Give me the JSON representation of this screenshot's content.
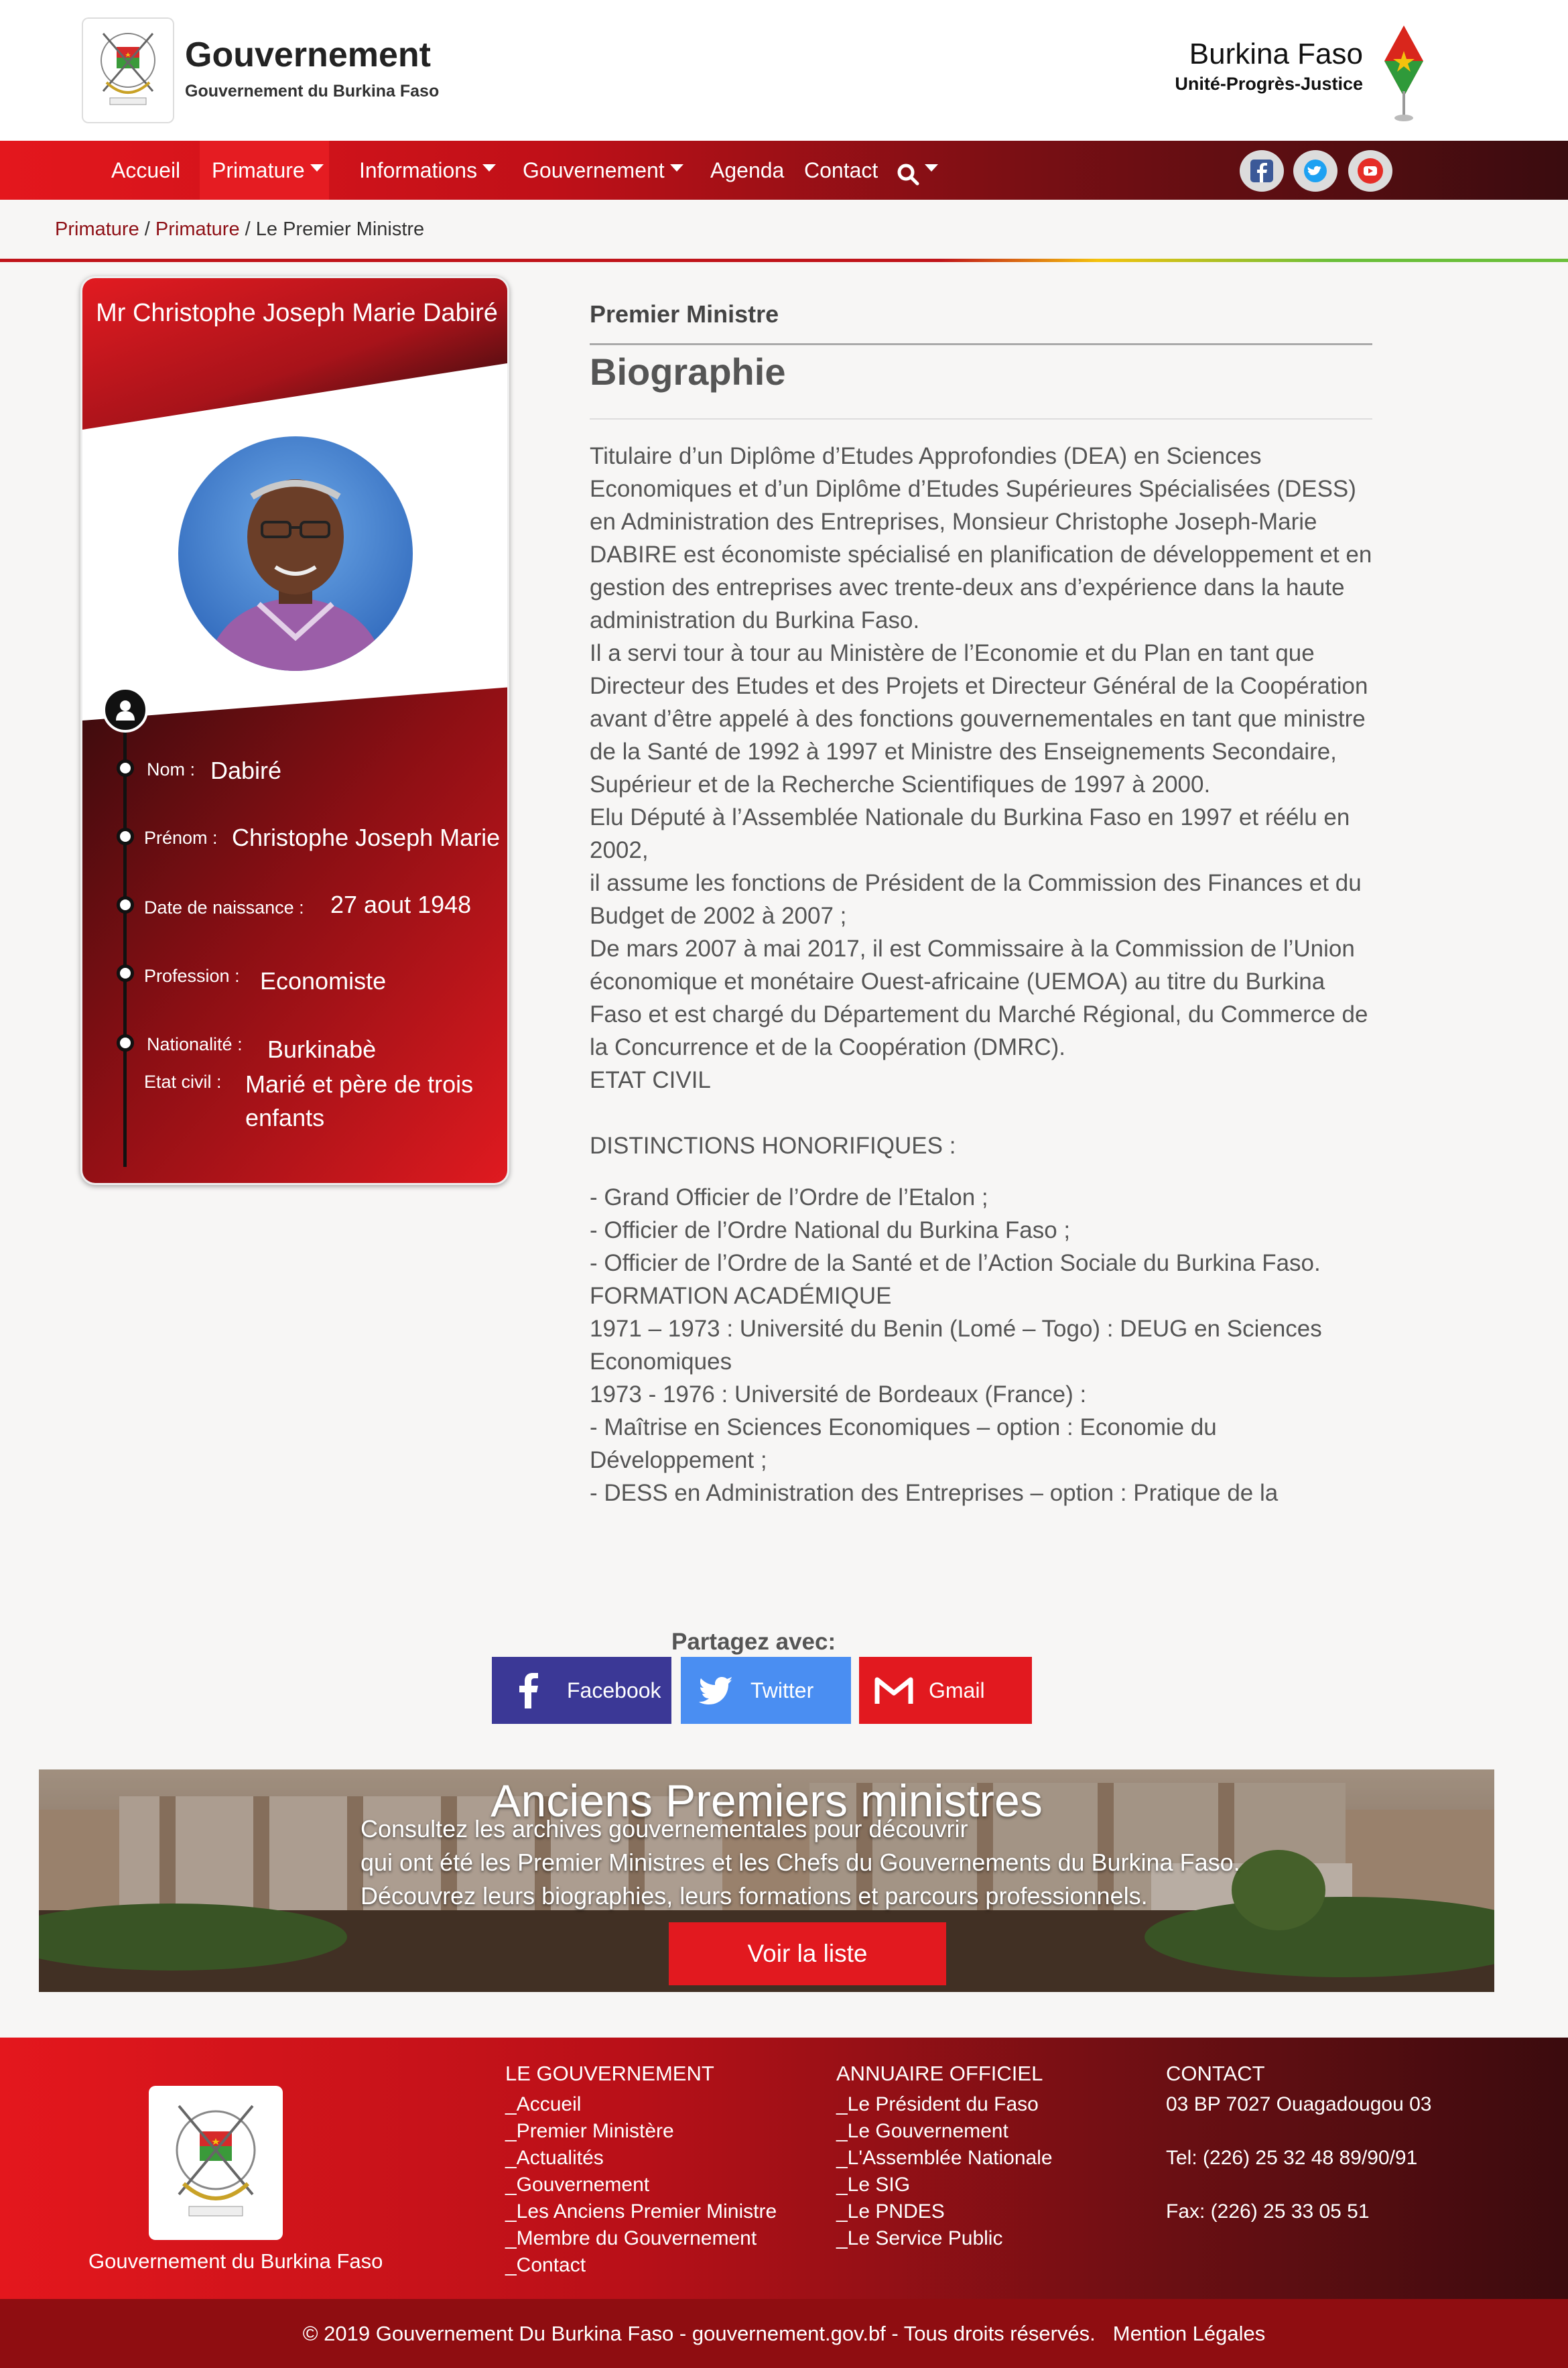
{
  "header": {
    "title": "Gouvernement",
    "subtitle": "Gouvernement du Burkina Faso",
    "country": "Burkina Faso",
    "motto": "Unité-Progrès-Justice"
  },
  "nav": {
    "items": [
      "Accueil",
      "Primature",
      "Informations",
      "Gouvernement",
      "Agenda",
      "Contact"
    ],
    "active": "Primature"
  },
  "social": [
    "facebook-icon",
    "twitter-icon",
    "youtube-icon"
  ],
  "breadcrumb": [
    "Primature",
    "Primature",
    "Le Premier Ministre"
  ],
  "profile": {
    "name": "Mr Christophe Joseph Marie Dabiré",
    "fields": [
      {
        "label": "Nom :",
        "value": "Dabiré"
      },
      {
        "label": "Prénom :",
        "value": "Christophe Joseph Marie"
      },
      {
        "label": "Date de naissance :",
        "value": "27 aout 1948"
      },
      {
        "label": "Profession :",
        "value": "Economiste"
      },
      {
        "label": "Nationalité :",
        "value": "Burkinabè"
      },
      {
        "label": "Etat civil :",
        "value": "Marié et père de trois enfants"
      }
    ]
  },
  "bio": {
    "kicker": "Premier Ministre",
    "title": "Biographie",
    "p1": "Titulaire d’un Diplôme d’Etudes Approfondies (DEA) en Sciences Economiques et d’un Diplôme d’Etudes Supérieures Spécialisées (DESS) en Administration des Entreprises, Monsieur Christophe Joseph-Marie DABIRE est économiste spécialisé en planification de développement et en gestion des entreprises avec trente-deux ans d’expérience dans la haute administration du Burkina Faso.",
    "p2": "Il a servi tour à tour au Ministère de l’Economie et du Plan en tant que Directeur des Etudes et des Projets et Directeur Général de la Coopération avant d’être appelé à des fonctions gouvernementales en tant que ministre de la Santé de 1992 à 1997 et Ministre des Enseignements Secondaire, Supérieur et de la Recherche Scientifiques de 1997 à 2000.",
    "p3": "Elu Député à l’Assemblée Nationale du Burkina Faso en 1997 et réélu en 2002,",
    "p4": "il assume les fonctions de Président de la Commission des Finances et du Budget de 2002 à 2007 ;",
    "p5": "De mars 2007 à mai 2017, il est Commissaire à la Commission de l’Union économique et monétaire Ouest-africaine (UEMOA) au titre du Burkina Faso et est chargé du Département du Marché Régional, du Commerce de la Concurrence et de la Coopération (DMRC).",
    "p6": "ETAT CIVIL",
    "p7": "DISTINCTIONS HONORIFIQUES :",
    "d1": "- Grand Officier de l’Ordre de l’Etalon ;",
    "d2": "- Officier de l’Ordre National du Burkina Faso ;",
    "d3": "- Officier de l’Ordre de la Santé et de l’Action Sociale du Burkina Faso.",
    "f0": "FORMATION ACADÉMIQUE",
    "f1": "1971 – 1973 : Université du Benin (Lomé – Togo) : DEUG en Sciences Economiques",
    "f2": "1973 - 1976 : Université de Bordeaux (France) :",
    "f3": "- Maîtrise en Sciences Economiques – option : Economie du Développement ;",
    "f4": "- DESS en Administration des Entreprises – option : Pratique de la"
  },
  "share": {
    "label": "Partagez avec:",
    "facebook": "Facebook",
    "twitter": "Twitter",
    "gmail": "Gmail",
    "colors": {
      "facebook": "#3b3896",
      "twitter": "#4a8ef2",
      "gmail": "#e2191f"
    }
  },
  "banner": {
    "title": "Anciens Premiers ministres",
    "line1": "Consultez les archives gouvernementales pour découvrir",
    "line2": "qui ont été les Premier Ministres et les Chefs du Gouvernements du Burkina Faso.",
    "line3": "Découvrez leurs biographies, leurs formations et parcours professionnels.",
    "button": "Voir la liste"
  },
  "footer": {
    "org": "Gouvernement du Burkina Faso",
    "col1": {
      "title": "LE GOUVERNEMENT",
      "links": [
        "_Accueil",
        "_Premier Ministère",
        "_Actualités",
        "_Gouvernement",
        "_Les Anciens Premier Ministre",
        "_Membre du Gouvernement",
        "_Contact"
      ]
    },
    "col2": {
      "title": "ANNUAIRE OFFICIEL",
      "links": [
        "_Le Président du Faso",
        "_Le Gouvernement",
        "_L'Assemblée Nationale",
        "_Le SIG",
        "_Le PNDES",
        "_Le Service Public"
      ]
    },
    "col3": {
      "title": "CONTACT",
      "address": "03 BP 7027 Ouagadougou 03",
      "tel": "Tel: (226) 25 32 48 89/90/91",
      "fax": "Fax: (226) 25 33 05 51"
    },
    "copyright": "© 2019 Gouvernement Du Burkina Faso - gouvernement.gov.bf - Tous droits réservés.",
    "legal": "Mention Légales"
  },
  "colors": {
    "brand_red": "#e4171d",
    "dark_red": "#3a0c0f",
    "accent_green": "#6bbf3a",
    "accent_yellow": "#f4c20d"
  }
}
